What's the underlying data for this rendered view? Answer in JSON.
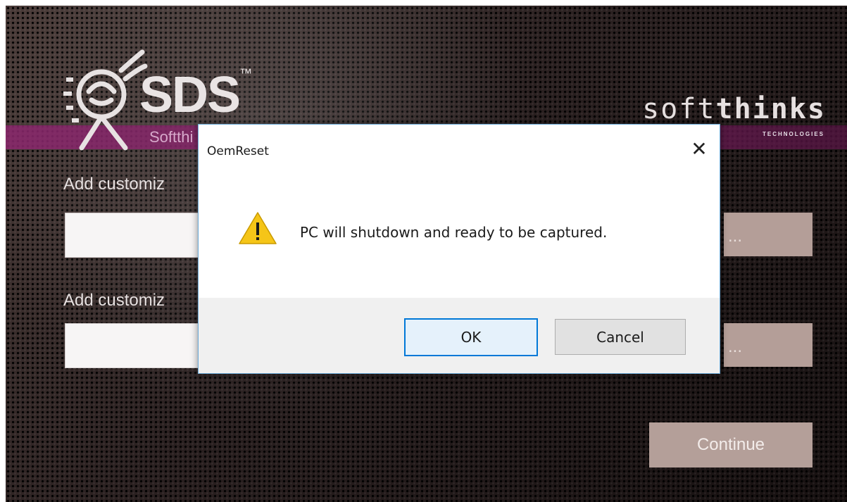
{
  "app": {
    "logo_text": "SDS",
    "logo_tm": "™",
    "banner_subtitle": "Softthi",
    "brand_plain": "soft",
    "brand_bold": "thinks",
    "brand_sub": "TECHNOLOGIES",
    "field1_label": "Add customiz",
    "field2_label": "Add customiz",
    "field1_value": "",
    "field2_value": "",
    "browse1_label": "...",
    "browse2_label": "...",
    "continue_label": "Continue"
  },
  "dialog": {
    "title": "OemReset",
    "close_glyph": "✕",
    "icon": "warning-icon",
    "message": "PC will shutdown and ready to be captured.",
    "ok_label": "OK",
    "cancel_label": "Cancel"
  },
  "colors": {
    "banner": "#8c286e",
    "continue_button": "#b49f99",
    "ok_border": "#0078d7",
    "warning": "#f5c518"
  }
}
